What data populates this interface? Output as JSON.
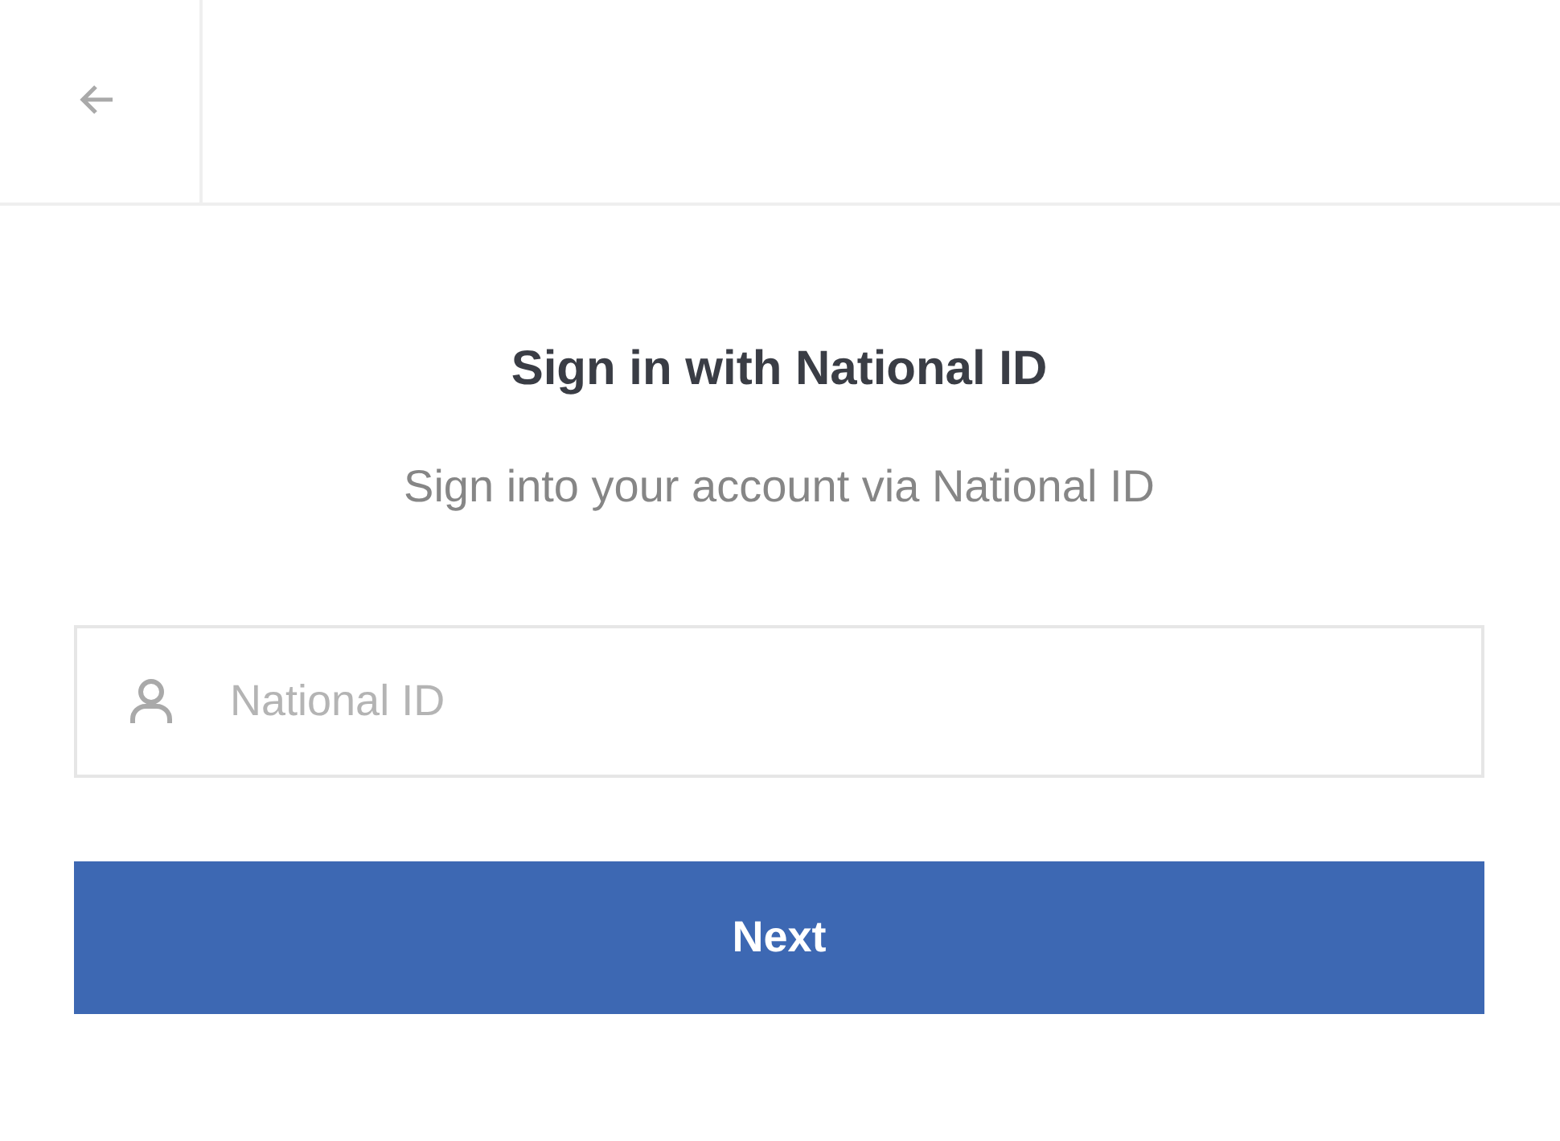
{
  "title": "Sign in with National ID",
  "subtitle": "Sign into your account via National ID",
  "national_id_field": {
    "placeholder": "National ID"
  },
  "next_button": {
    "label": "Next"
  }
}
